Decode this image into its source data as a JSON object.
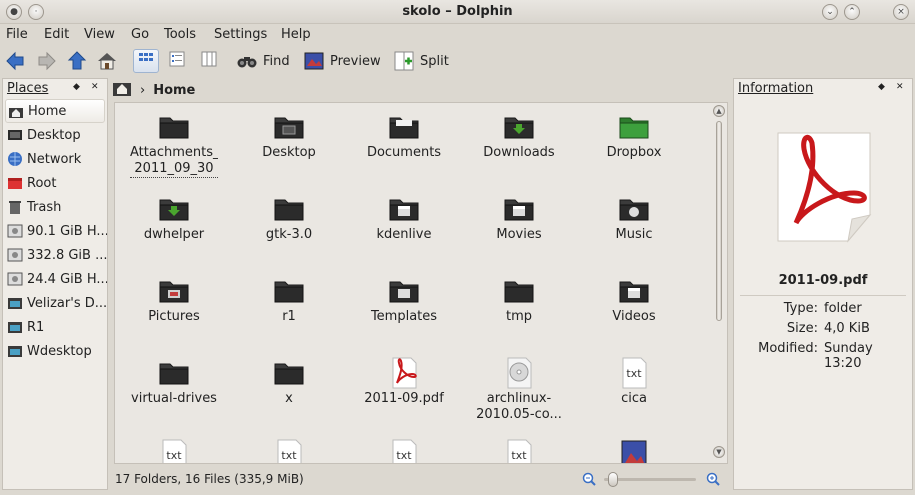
{
  "window": {
    "title": "skolo – Dolphin"
  },
  "menu": [
    {
      "label": "File"
    },
    {
      "label": "Edit"
    },
    {
      "label": "View"
    },
    {
      "label": "Go"
    },
    {
      "label": "Tools"
    },
    {
      "label": "Settings"
    },
    {
      "label": "Help"
    }
  ],
  "toolbar": {
    "find": "Find",
    "preview": "Preview",
    "split": "Split"
  },
  "places": {
    "title": "Places",
    "items": [
      {
        "label": "Home",
        "icon": "home-icon",
        "selected": true
      },
      {
        "label": "Desktop",
        "icon": "desktop-icon"
      },
      {
        "label": "Network",
        "icon": "network-icon"
      },
      {
        "label": "Root",
        "icon": "root-folder-icon"
      },
      {
        "label": "Trash",
        "icon": "trash-icon"
      },
      {
        "label": "90.1 GiB H...",
        "icon": "hard-drive-icon"
      },
      {
        "label": "332.8 GiB ...",
        "icon": "hard-drive-icon"
      },
      {
        "label": "24.4 GiB H...",
        "icon": "hard-drive-icon"
      },
      {
        "label": "Velizar's D...",
        "icon": "folder-image-icon"
      },
      {
        "label": "R1",
        "icon": "folder-image-icon"
      },
      {
        "label": "Wdesktop",
        "icon": "folder-image-icon"
      }
    ]
  },
  "breadcrumb": {
    "current": "Home"
  },
  "files": [
    {
      "name": "Attachments_ 2011_09_30",
      "type": "folder",
      "focused": true
    },
    {
      "name": "Desktop",
      "type": "folder-desktop"
    },
    {
      "name": "Documents",
      "type": "folder-documents"
    },
    {
      "name": "Downloads",
      "type": "folder-downloads"
    },
    {
      "name": "Dropbox",
      "type": "folder-dropbox"
    },
    {
      "name": "dwhelper",
      "type": "folder-downloads"
    },
    {
      "name": "gtk-3.0",
      "type": "folder"
    },
    {
      "name": "kdenlive",
      "type": "folder-video"
    },
    {
      "name": "Movies",
      "type": "folder-video"
    },
    {
      "name": "Music",
      "type": "folder-music"
    },
    {
      "name": "Pictures",
      "type": "folder-pictures"
    },
    {
      "name": "r1",
      "type": "folder"
    },
    {
      "name": "Templates",
      "type": "folder-templates"
    },
    {
      "name": "tmp",
      "type": "folder"
    },
    {
      "name": "Videos",
      "type": "folder-video"
    },
    {
      "name": "virtual-drives",
      "type": "folder"
    },
    {
      "name": "x",
      "type": "folder"
    },
    {
      "name": "2011-09.pdf",
      "type": "pdf"
    },
    {
      "name": "archlinux-2010.05-co...",
      "type": "disc-image"
    },
    {
      "name": "cica",
      "type": "text"
    },
    {
      "name": "",
      "type": "text"
    },
    {
      "name": "",
      "type": "text"
    },
    {
      "name": "",
      "type": "text"
    },
    {
      "name": "",
      "type": "text"
    },
    {
      "name": "",
      "type": "image"
    }
  ],
  "status": {
    "text": "17 Folders, 16 Files (335,9 MiB)",
    "zoom_level": 0.1
  },
  "information": {
    "title": "Information",
    "file_name": "2011-09.pdf",
    "type_label": "Type:",
    "type_value": "folder",
    "size_label": "Size:",
    "size_value": "4,0 KiB",
    "modified_label": "Modified:",
    "modified_value": "Sunday 13:20"
  },
  "colors": {
    "selection": "#9fb4d0",
    "folder_dark": "#2b2b2b",
    "pdf_red": "#c8181b"
  }
}
